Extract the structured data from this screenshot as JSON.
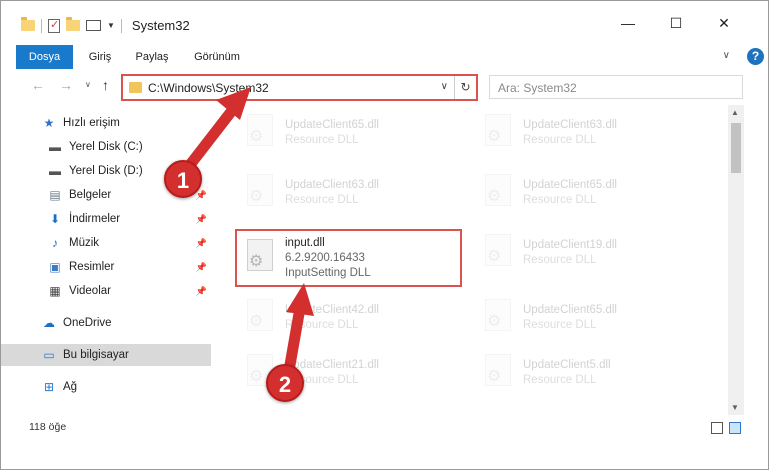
{
  "window": {
    "title": "System32",
    "controls": {
      "minimize": "—",
      "maximize": "☐",
      "close": "✕"
    }
  },
  "ribbon": {
    "tabs": [
      {
        "label": "Dosya",
        "active": true
      },
      {
        "label": "Giriş",
        "active": false
      },
      {
        "label": "Paylaş",
        "active": false
      },
      {
        "label": "Görünüm",
        "active": false
      }
    ],
    "help": "?"
  },
  "address": {
    "path": "C:\\Windows\\System32",
    "search_placeholder": "Ara: System32"
  },
  "sidebar": {
    "items": [
      {
        "label": "Hızlı erişim",
        "icon": "star-icon"
      },
      {
        "label": "Yerel Disk (C:)",
        "icon": "drive-icon"
      },
      {
        "label": "Yerel Disk (D:)",
        "icon": "drive-icon"
      },
      {
        "label": "Belgeler",
        "icon": "documents-icon",
        "pinned": true
      },
      {
        "label": "İndirmeler",
        "icon": "download-icon",
        "pinned": true
      },
      {
        "label": "Müzik",
        "icon": "music-icon",
        "pinned": true
      },
      {
        "label": "Resimler",
        "icon": "pictures-icon",
        "pinned": true
      },
      {
        "label": "Videolar",
        "icon": "videos-icon",
        "pinned": true
      },
      {
        "label": "OneDrive",
        "icon": "cloud-icon"
      },
      {
        "label": "Bu bilgisayar",
        "icon": "computer-icon",
        "selected": true
      },
      {
        "label": "Ağ",
        "icon": "network-icon"
      }
    ]
  },
  "files": {
    "left": [
      {
        "name": "UpdateClient65.dll",
        "desc": "Resource DLL"
      },
      {
        "name": "UpdateClient63.dll",
        "desc": "Resource DLL"
      },
      {
        "name": "input.dll",
        "version": "6.2.9200.16433",
        "desc": "InputSetting DLL",
        "highlighted": true
      },
      {
        "name": "UpdateClient42.dll",
        "desc": "Resource DLL"
      },
      {
        "name": "UpdateClient21.dll",
        "desc": "Resource DLL"
      }
    ],
    "right": [
      {
        "name": "UpdateClient63.dll",
        "desc": "Resource DLL"
      },
      {
        "name": "UpdateClient65.dll",
        "desc": "Resource DLL"
      },
      {
        "name": "UpdateClient19.dll",
        "desc": "Resource DLL"
      },
      {
        "name": "UpdateClient65.dll",
        "desc": "Resource DLL"
      },
      {
        "name": "UpdateClient5.dll",
        "desc": "Resource DLL"
      }
    ]
  },
  "status": {
    "count": "118 öğe"
  },
  "annotations": {
    "step1": "1",
    "step2": "2",
    "color": "#d32f2f"
  }
}
